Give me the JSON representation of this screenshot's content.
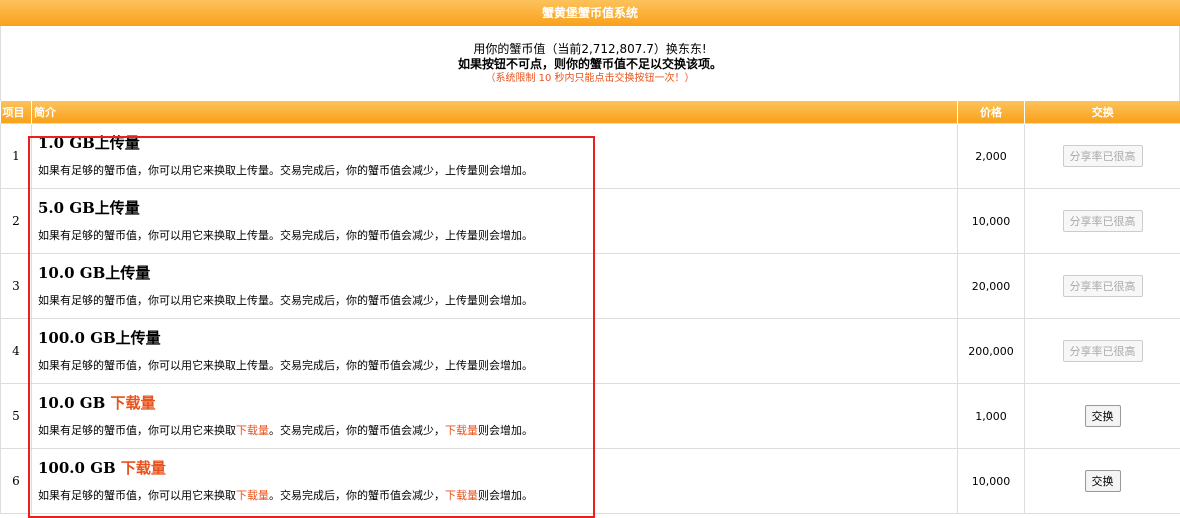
{
  "header": {
    "title": "蟹黄堡蟹币值系统"
  },
  "info": {
    "line1": "用你的蟹币值（当前2,712,807.7）换东东!",
    "line2": "如果按钮不可点，则你的蟹币值不足以交换该项。",
    "line3": "（系统限制 10 秒内只能点击交换按钮一次！）"
  },
  "table": {
    "columns": {
      "index": "项目",
      "desc": "简介",
      "price": "价格",
      "action": "交换"
    },
    "rows": [
      {
        "index": "1",
        "title_prefix": "1.0 GB上传量",
        "title_highlight": "",
        "desc_a": "如果有足够的蟹币值，你可以用它来换取上传量。交易完成后，你的蟹币值会减少，上传量则会增加。",
        "desc_b": "",
        "desc_c": "",
        "desc_d": "",
        "desc_e": "",
        "price": "2,000",
        "button": "分享率已很高",
        "disabled": true
      },
      {
        "index": "2",
        "title_prefix": "5.0 GB上传量",
        "title_highlight": "",
        "desc_a": "如果有足够的蟹币值，你可以用它来换取上传量。交易完成后，你的蟹币值会减少，上传量则会增加。",
        "desc_b": "",
        "desc_c": "",
        "desc_d": "",
        "desc_e": "",
        "price": "10,000",
        "button": "分享率已很高",
        "disabled": true
      },
      {
        "index": "3",
        "title_prefix": "10.0 GB上传量",
        "title_highlight": "",
        "desc_a": "如果有足够的蟹币值，你可以用它来换取上传量。交易完成后，你的蟹币值会减少，上传量则会增加。",
        "desc_b": "",
        "desc_c": "",
        "desc_d": "",
        "desc_e": "",
        "price": "20,000",
        "button": "分享率已很高",
        "disabled": true
      },
      {
        "index": "4",
        "title_prefix": "100.0 GB上传量",
        "title_highlight": "",
        "desc_a": "如果有足够的蟹币值，你可以用它来换取上传量。交易完成后，你的蟹币值会减少，上传量则会增加。",
        "desc_b": "",
        "desc_c": "",
        "desc_d": "",
        "desc_e": "",
        "price": "200,000",
        "button": "分享率已很高",
        "disabled": true
      },
      {
        "index": "5",
        "title_prefix": "10.0 GB ",
        "title_highlight": "下载量",
        "desc_a": "如果有足够的蟹币值，你可以用它来换取",
        "desc_b": "下载量",
        "desc_c": "。交易完成后，你的蟹币值会减少，",
        "desc_d": "下载量",
        "desc_e": "则会增加。",
        "price": "1,000",
        "button": "交换",
        "disabled": false
      },
      {
        "index": "6",
        "title_prefix": "100.0 GB ",
        "title_highlight": "下载量",
        "desc_a": "如果有足够的蟹币值，你可以用它来换取",
        "desc_b": "下载量",
        "desc_c": "。交易完成后，你的蟹币值会减少，",
        "desc_d": "下载量",
        "desc_e": "则会增加。",
        "price": "10,000",
        "button": "交换",
        "disabled": false
      }
    ]
  },
  "colors": {
    "header_orange": "#f9a11b",
    "highlight": "#e8531d",
    "annotation_box": "#e8211c"
  }
}
